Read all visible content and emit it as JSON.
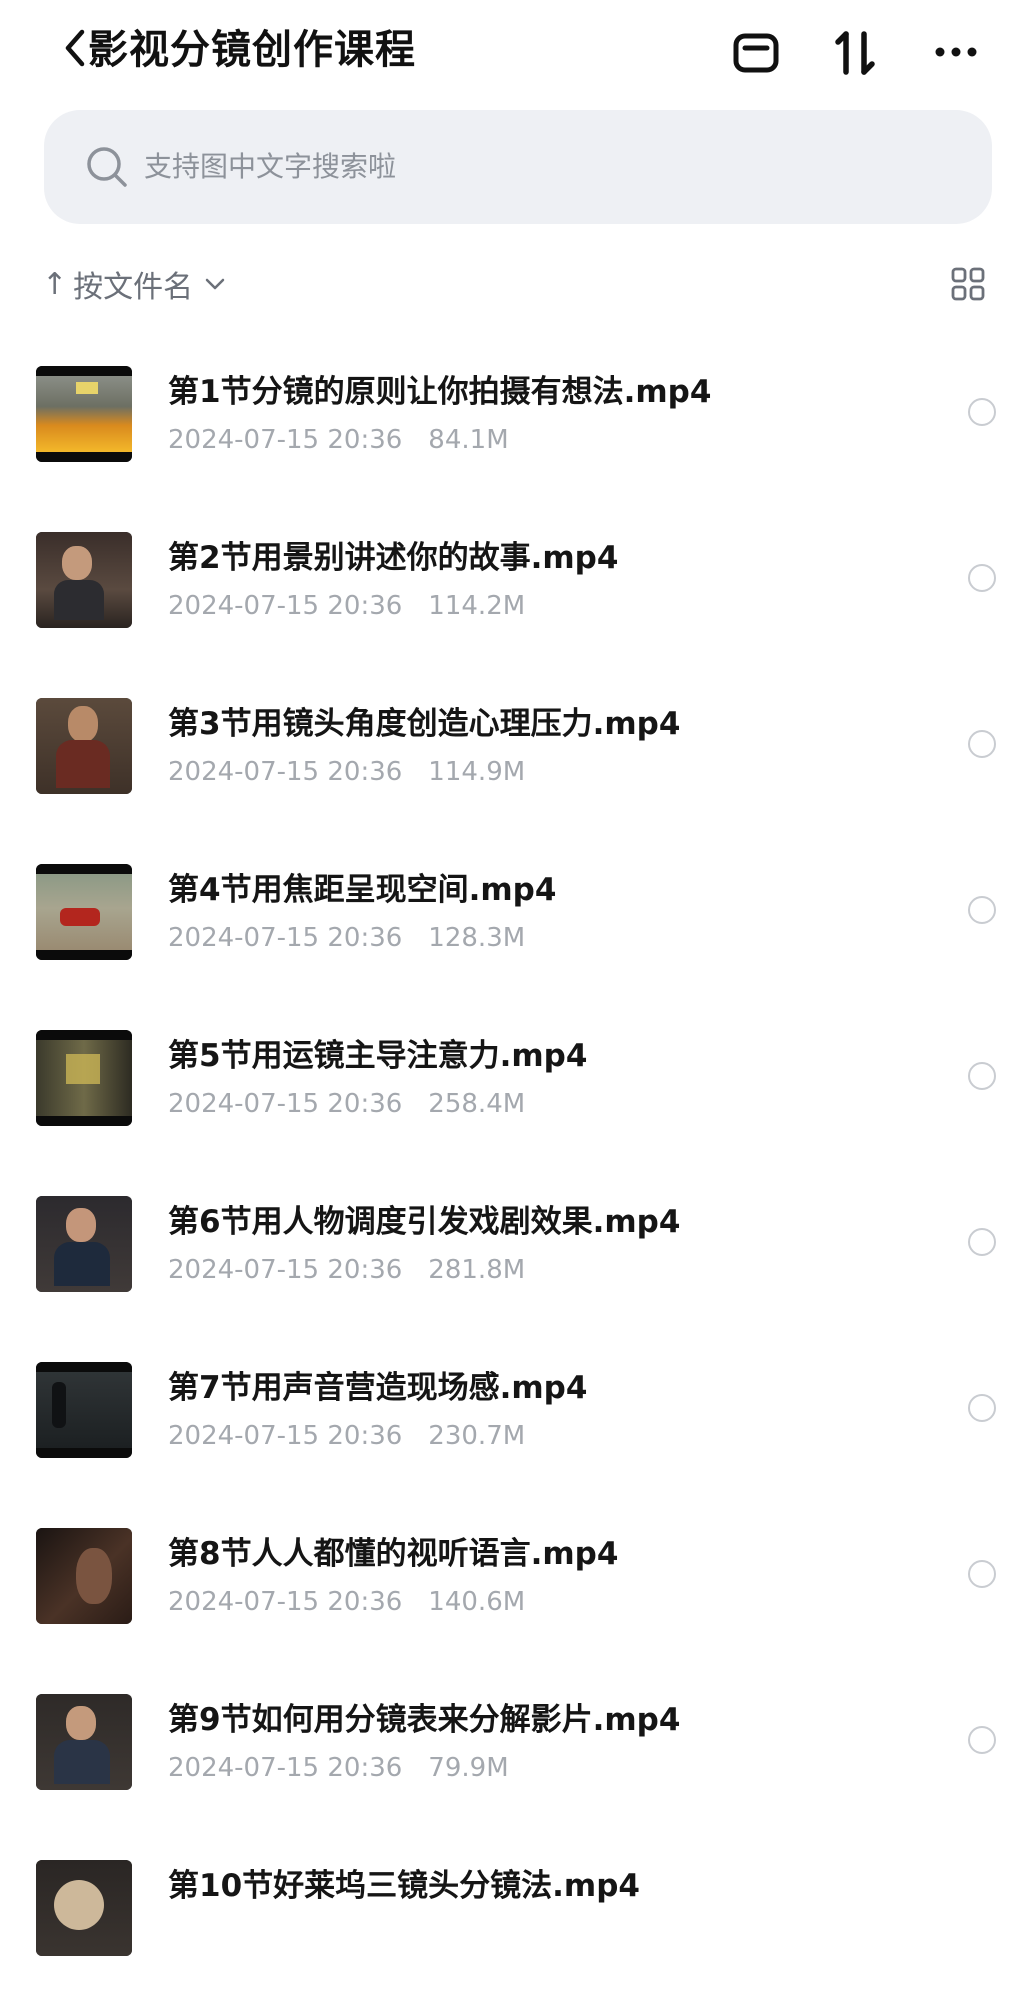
{
  "header": {
    "title": "影视分镜创作课程"
  },
  "search": {
    "placeholder": "支持图中文字搜索啦"
  },
  "sort": {
    "arrow": "↑",
    "label": "按文件名"
  },
  "files": [
    {
      "name": "第1节分镜的原则让你拍摄有想法.mp4",
      "date": "2024-07-15 20:36",
      "size": "84.1M"
    },
    {
      "name": "第2节用景别讲述你的故事.mp4",
      "date": "2024-07-15 20:36",
      "size": "114.2M"
    },
    {
      "name": "第3节用镜头角度创造心理压力.mp4",
      "date": "2024-07-15 20:36",
      "size": "114.9M"
    },
    {
      "name": "第4节用焦距呈现空间.mp4",
      "date": "2024-07-15 20:36",
      "size": "128.3M"
    },
    {
      "name": "第5节用运镜主导注意力.mp4",
      "date": "2024-07-15 20:36",
      "size": "258.4M"
    },
    {
      "name": "第6节用人物调度引发戏剧效果.mp4",
      "date": "2024-07-15 20:36",
      "size": "281.8M"
    },
    {
      "name": "第7节用声音营造现场感.mp4",
      "date": "2024-07-15 20:36",
      "size": "230.7M"
    },
    {
      "name": "第8节人人都懂的视听语言.mp4",
      "date": "2024-07-15 20:36",
      "size": "140.6M"
    },
    {
      "name": "第9节如何用分镜表来分解影片.mp4",
      "date": "2024-07-15 20:36",
      "size": "79.9M"
    },
    {
      "name": "第10节好莱坞三镜头分镜法.mp4",
      "date": "",
      "size": ""
    }
  ]
}
